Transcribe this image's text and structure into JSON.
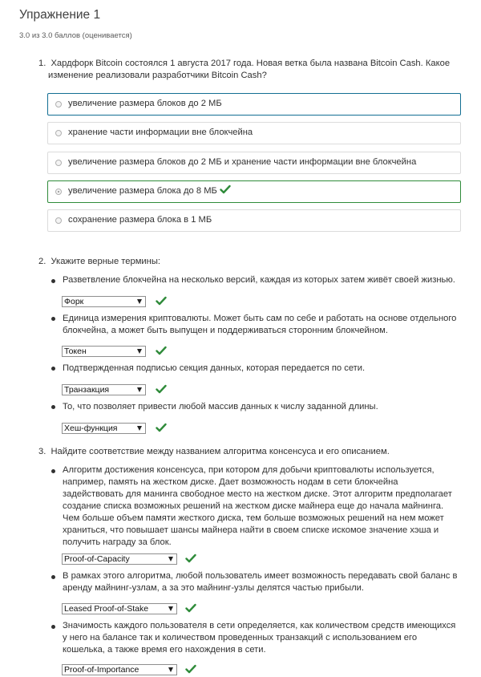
{
  "header": {
    "title": "Упражнение 1",
    "score": "3.0 из 3.0 баллов (оценивается)"
  },
  "question1": {
    "number": "1.",
    "text_line1": "Хардфорк Bitcoin состоялся 1 августа 2017 года. Новая ветка была названа Bitcoin Cash. Какое",
    "text_line2": "изменение реализовали разработчики Bitcoin Cash?",
    "options": [
      {
        "label": "увеличение размера блоков до 2 МБ"
      },
      {
        "label": "хранение части информации вне блокчейна"
      },
      {
        "label": "увеличение размера блоков до 2 МБ и хранение части информации вне блокчейна"
      },
      {
        "label": "увеличение размера блока до 8 МБ"
      },
      {
        "label": "сохранение размера блока в 1 МБ"
      }
    ],
    "correct_index": 3
  },
  "question2": {
    "number": "2.",
    "text": "Укажите верные термины:",
    "items": [
      {
        "line1": "Разветвление блокчейна на несколько версий, каждая из которых затем живёт своей жизнью.",
        "answer": "Форк"
      },
      {
        "line1": "Единица измерения криптовалюты. Может быть сам по себе и работать на основе отдельного",
        "line2": "блокчейна, а может быть выпущен и поддерживаться сторонним блокчейном.",
        "answer": "Токен"
      },
      {
        "line1": "Подтвержденная подписью секция данных, которая передается по сети.",
        "answer": "Транзакция"
      },
      {
        "line1": "То, что позволяет привести любой массив данных к числу заданной длины.",
        "answer": "Хеш-функция"
      }
    ]
  },
  "question3": {
    "number": "3.",
    "text": "Найдите соответствие между названием алгоритма консенсуса и его описанием.",
    "items": [
      {
        "lines": [
          "Алгоритм достижения консенсуса, при котором для добычи криптовалюты используется,",
          "например, память на жестком диске. Дает возможность нодам в сети блокчейна",
          "задействовать для манинга свободное место на жестком диске. Этот алгоритм предполагает",
          "создание списка возможных решений на жестком диске майнера еще до начала майнинга.",
          "Чем больше объем памяти жесткого диска, тем больше возможных решений на нем может",
          "храниться, что повышает шансы майнера найти в своем списке искомое значение хэша и",
          "получить награду за блок."
        ],
        "answer": "Proof-of-Capacity"
      },
      {
        "lines": [
          "В рамках этого алгоритма, любой пользователь имеет возможность передавать свой баланс в",
          "аренду майнинг-узлам, а за это майнинг-узлы делятся частью прибыли."
        ],
        "answer": "Leased Proof-of-Stake"
      },
      {
        "lines": [
          "Значимость каждого пользователя в сети определяется, как количеством средств имеющихся",
          "у него на балансе так и количеством проведенных транзакций с использованием его",
          "кошелька, а также время его нахождения в сети."
        ],
        "answer": "Proof-of-Importance"
      }
    ]
  },
  "colors": {
    "check_green": "#2f8b3a",
    "selected_border": "#126e93",
    "text": "#313131"
  },
  "icons": {
    "correct": "check-icon",
    "dropdown": "chevron-down-icon"
  }
}
